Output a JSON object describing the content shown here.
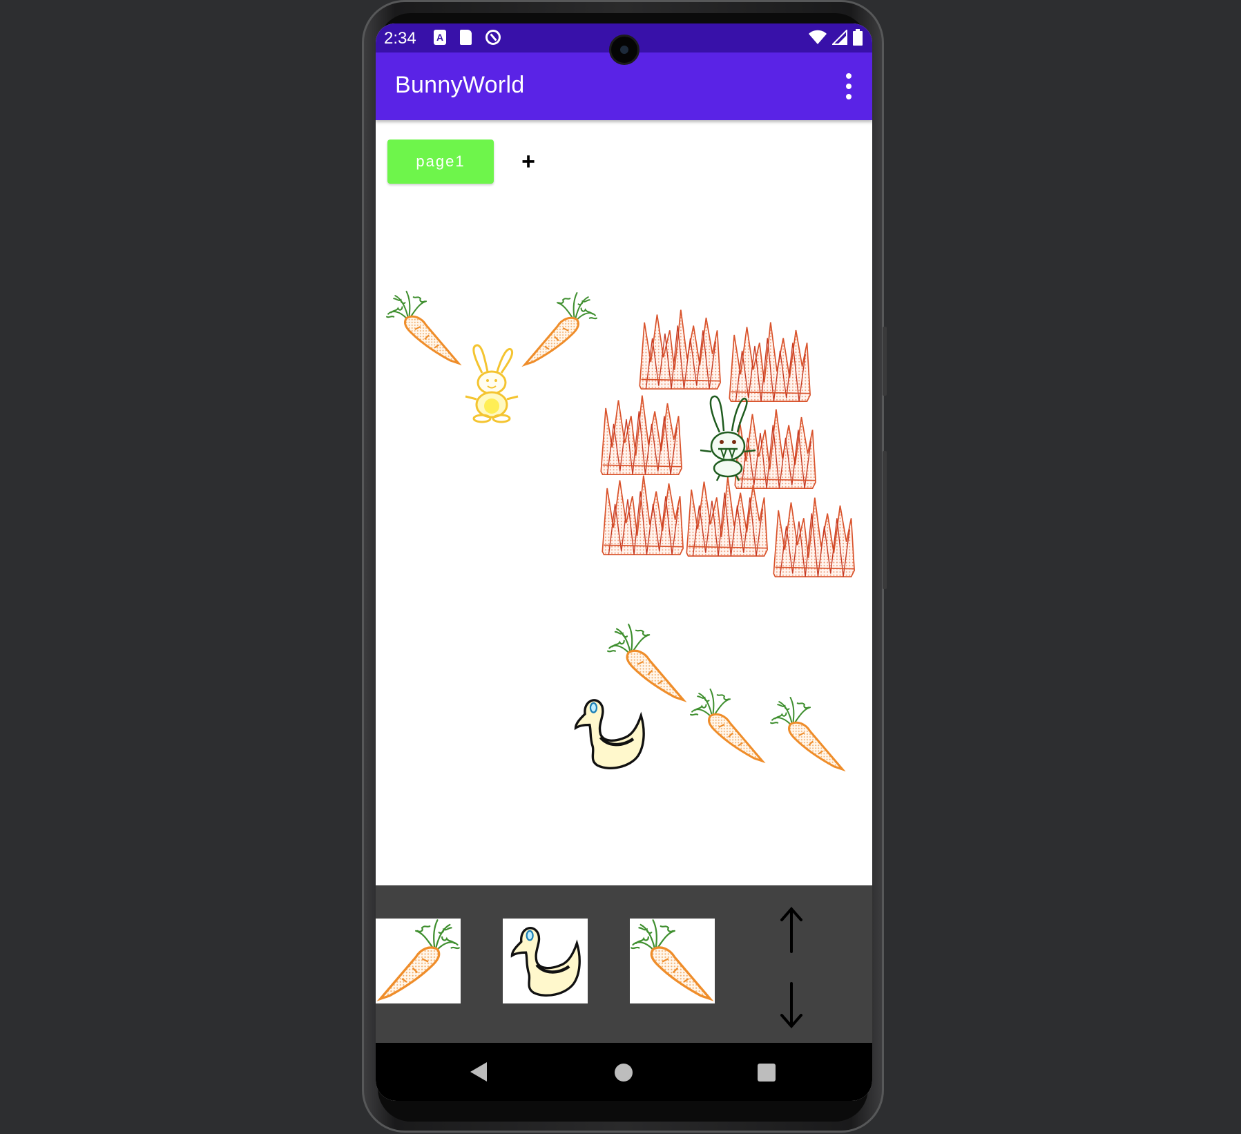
{
  "status_bar": {
    "time": "2:34",
    "left_icons": [
      "text-a-icon",
      "sd-card-icon",
      "do-not-disturb-icon"
    ],
    "right_icons": [
      "wifi-icon",
      "cell-signal-icon",
      "battery-icon"
    ]
  },
  "app_bar": {
    "title": "BunnyWorld",
    "overflow_icon": "more-vert-icon"
  },
  "tabs": {
    "items": [
      {
        "label": "page1",
        "selected": true
      }
    ],
    "add_label": "+"
  },
  "canvas": {
    "sprites": [
      "carrot",
      "carrot",
      "yellow-bunny",
      "fire",
      "fire",
      "fire",
      "fire",
      "fire",
      "fire",
      "fire",
      "evil-bunny",
      "carrot",
      "duck",
      "carrot",
      "carrot"
    ]
  },
  "tray": {
    "thumbnails": [
      "carrot",
      "duck",
      "carrot"
    ],
    "scroll_up_icon": "arrow-up-icon",
    "scroll_down_icon": "arrow-down-icon"
  },
  "nav_bar": {
    "icons": [
      "back-icon",
      "home-icon",
      "recents-icon"
    ]
  },
  "colors": {
    "status_bar": "#3811a9",
    "app_bar": "#5a23e6",
    "tab": "#6ef54b",
    "tray": "#424242",
    "carrot": "#f29a3c",
    "carrot_leaves": "#3f8f2f",
    "fire": "#d9532c"
  }
}
